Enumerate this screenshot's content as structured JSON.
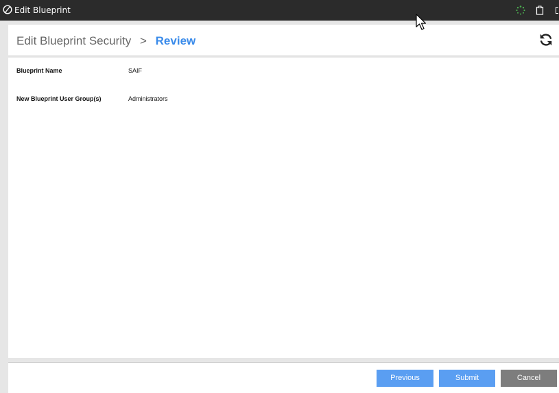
{
  "window": {
    "title": "Edit Blueprint"
  },
  "header": {
    "breadcrumb_parent": "Edit Blueprint Security",
    "breadcrumb_separator": ">",
    "breadcrumb_current": "Review",
    "refresh_icon": "refresh-icon"
  },
  "review": {
    "fields": [
      {
        "label": "Blueprint Name",
        "value": "SAIF"
      },
      {
        "label": "New Blueprint User Group(s)",
        "value": "Administrators"
      }
    ]
  },
  "footer": {
    "previous_label": "Previous",
    "submit_label": "Submit",
    "cancel_label": "Cancel"
  },
  "colors": {
    "titlebar": "#2b2b2b",
    "accent": "#3a8bea",
    "primary_button": "#5a9ef2",
    "cancel_button": "#7d7d7d",
    "spinner": "#4caf50"
  }
}
